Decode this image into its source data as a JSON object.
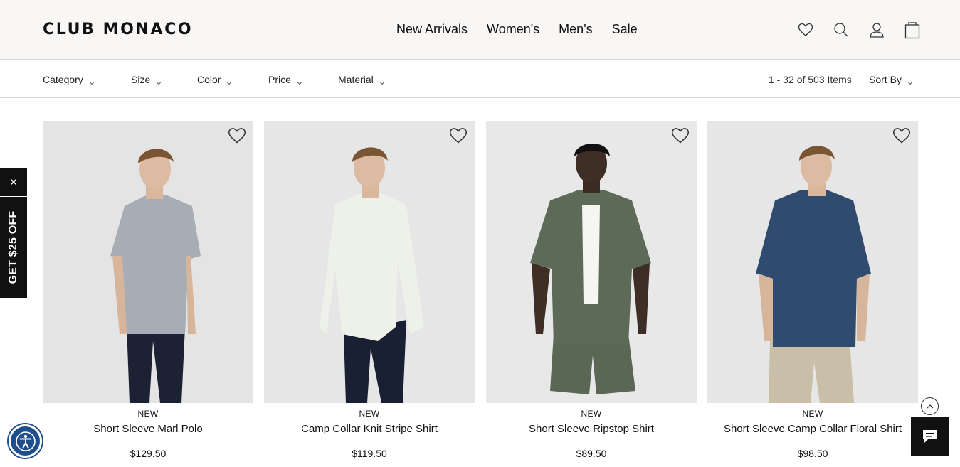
{
  "header": {
    "logo": "CLUB MONACO",
    "nav": [
      "New Arrivals",
      "Women's",
      "Men's",
      "Sale"
    ],
    "icons": [
      "heart-icon",
      "search-icon",
      "user-icon",
      "bag-icon"
    ]
  },
  "filters": {
    "items": [
      "Category",
      "Size",
      "Color",
      "Price",
      "Material"
    ],
    "count": "1 - 32 of 503 Items",
    "sort_label": "Sort By"
  },
  "products": [
    {
      "badge": "NEW",
      "name": "Short Sleeve Marl Polo",
      "price": "$129.50",
      "shirt_color": "#a7adb5",
      "bottom_color": "#1c2233",
      "bg": "#e4e4e4"
    },
    {
      "badge": "NEW",
      "name": "Camp Collar Knit Stripe Shirt",
      "price": "$119.50",
      "shirt_color": "#eef0ea",
      "bottom_color": "#1a2033",
      "bg": "#e6e6e6"
    },
    {
      "badge": "NEW",
      "name": "Short Sleeve Ripstop Shirt",
      "price": "$89.50",
      "shirt_color": "#5d6a57",
      "bottom_color": "#5a6754",
      "bg": "#e8e8e8"
    },
    {
      "badge": "NEW",
      "name": "Short Sleeve Camp Collar Floral Shirt",
      "price": "$98.50",
      "shirt_color": "#2f4c6e",
      "bottom_color": "#c9bfa9",
      "bg": "#e6e6e6"
    }
  ],
  "promo": {
    "close": "×",
    "label": "GET $25 OFF"
  },
  "colors": {
    "header_bg": "#f8f7f6",
    "accent_dark": "#111111",
    "a11y_blue": "#1f4e8c"
  }
}
